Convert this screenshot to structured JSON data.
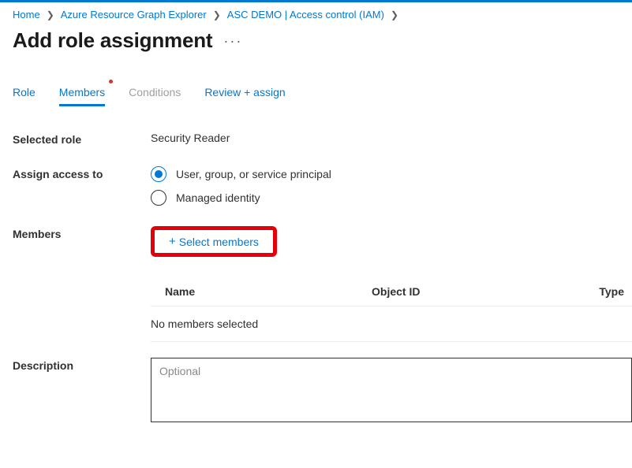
{
  "breadcrumb": {
    "items": [
      {
        "label": "Home"
      },
      {
        "label": "Azure Resource Graph Explorer"
      },
      {
        "label": "ASC DEMO | Access control (IAM)"
      }
    ]
  },
  "page": {
    "title": "Add role assignment"
  },
  "tabs": {
    "items": [
      {
        "label": "Role",
        "state": "link"
      },
      {
        "label": "Members",
        "state": "active",
        "hasIndicator": true
      },
      {
        "label": "Conditions",
        "state": "disabled"
      },
      {
        "label": "Review + assign",
        "state": "link"
      }
    ]
  },
  "form": {
    "selected_role_label": "Selected role",
    "selected_role_value": "Security Reader",
    "assign_access_label": "Assign access to",
    "assign_options": {
      "user_group_sp": "User, group, or service principal",
      "managed_identity": "Managed identity"
    },
    "members_label": "Members",
    "select_members_button": "Select members",
    "description_label": "Description",
    "description_placeholder": "Optional"
  },
  "members_table": {
    "headers": {
      "name": "Name",
      "object_id": "Object ID",
      "type": "Type"
    },
    "empty_text": "No members selected"
  }
}
